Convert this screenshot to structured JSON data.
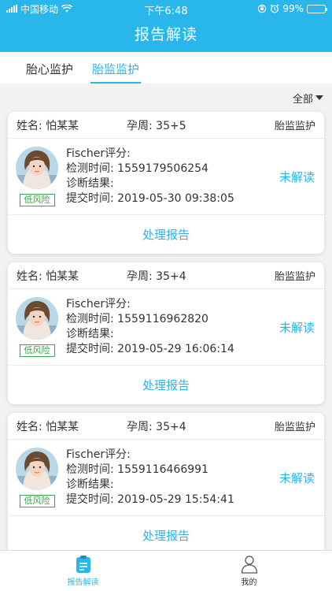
{
  "status_bar": {
    "carrier": "中国移动",
    "time": "下午6:48",
    "battery": "99%",
    "icons": [
      "signal-icon",
      "wifi-icon",
      "orientation-lock-icon",
      "alarm-icon",
      "battery-icon"
    ]
  },
  "header": {
    "title": "报告解读"
  },
  "tabs": [
    {
      "label": "胎心监护",
      "active": false
    },
    {
      "label": "胎监监护",
      "active": true
    }
  ],
  "filter": {
    "label": "全部"
  },
  "colors": {
    "accent": "#29b6ea",
    "risk_low": "#3aa54a"
  },
  "records": [
    {
      "name_label": "姓名:",
      "name": "怕某某",
      "week_label": "孕周:",
      "week": "35+5",
      "type": "胎监监护",
      "risk": "低风险",
      "score_label": "Fischer评分:",
      "score": "",
      "detect_label": "检测时间:",
      "detect_time": "1559179506254",
      "diagnosis_label": "诊断结果:",
      "diagnosis": "",
      "submit_label": "提交时间:",
      "submit_time": "2019-05-30 09:38:05",
      "status": "未解读",
      "action": "处理报告"
    },
    {
      "name_label": "姓名:",
      "name": "怕某某",
      "week_label": "孕周:",
      "week": "35+4",
      "type": "胎监监护",
      "risk": "低风险",
      "score_label": "Fischer评分:",
      "score": "",
      "detect_label": "检测时间:",
      "detect_time": "1559116962820",
      "diagnosis_label": "诊断结果:",
      "diagnosis": "",
      "submit_label": "提交时间:",
      "submit_time": "2019-05-29 16:06:14",
      "status": "未解读",
      "action": "处理报告"
    },
    {
      "name_label": "姓名:",
      "name": "怕某某",
      "week_label": "孕周:",
      "week": "35+4",
      "type": "胎监监护",
      "risk": "低风险",
      "score_label": "Fischer评分:",
      "score": "",
      "detect_label": "检测时间:",
      "detect_time": "1559116466991",
      "diagnosis_label": "诊断结果:",
      "diagnosis": "",
      "submit_label": "提交时间:",
      "submit_time": "2019-05-29 15:54:41",
      "status": "未解读",
      "action": "处理报告"
    }
  ],
  "tabbar": [
    {
      "label": "报告解读",
      "icon": "report-icon",
      "active": true
    },
    {
      "label": "我的",
      "icon": "user-icon",
      "active": false
    }
  ]
}
